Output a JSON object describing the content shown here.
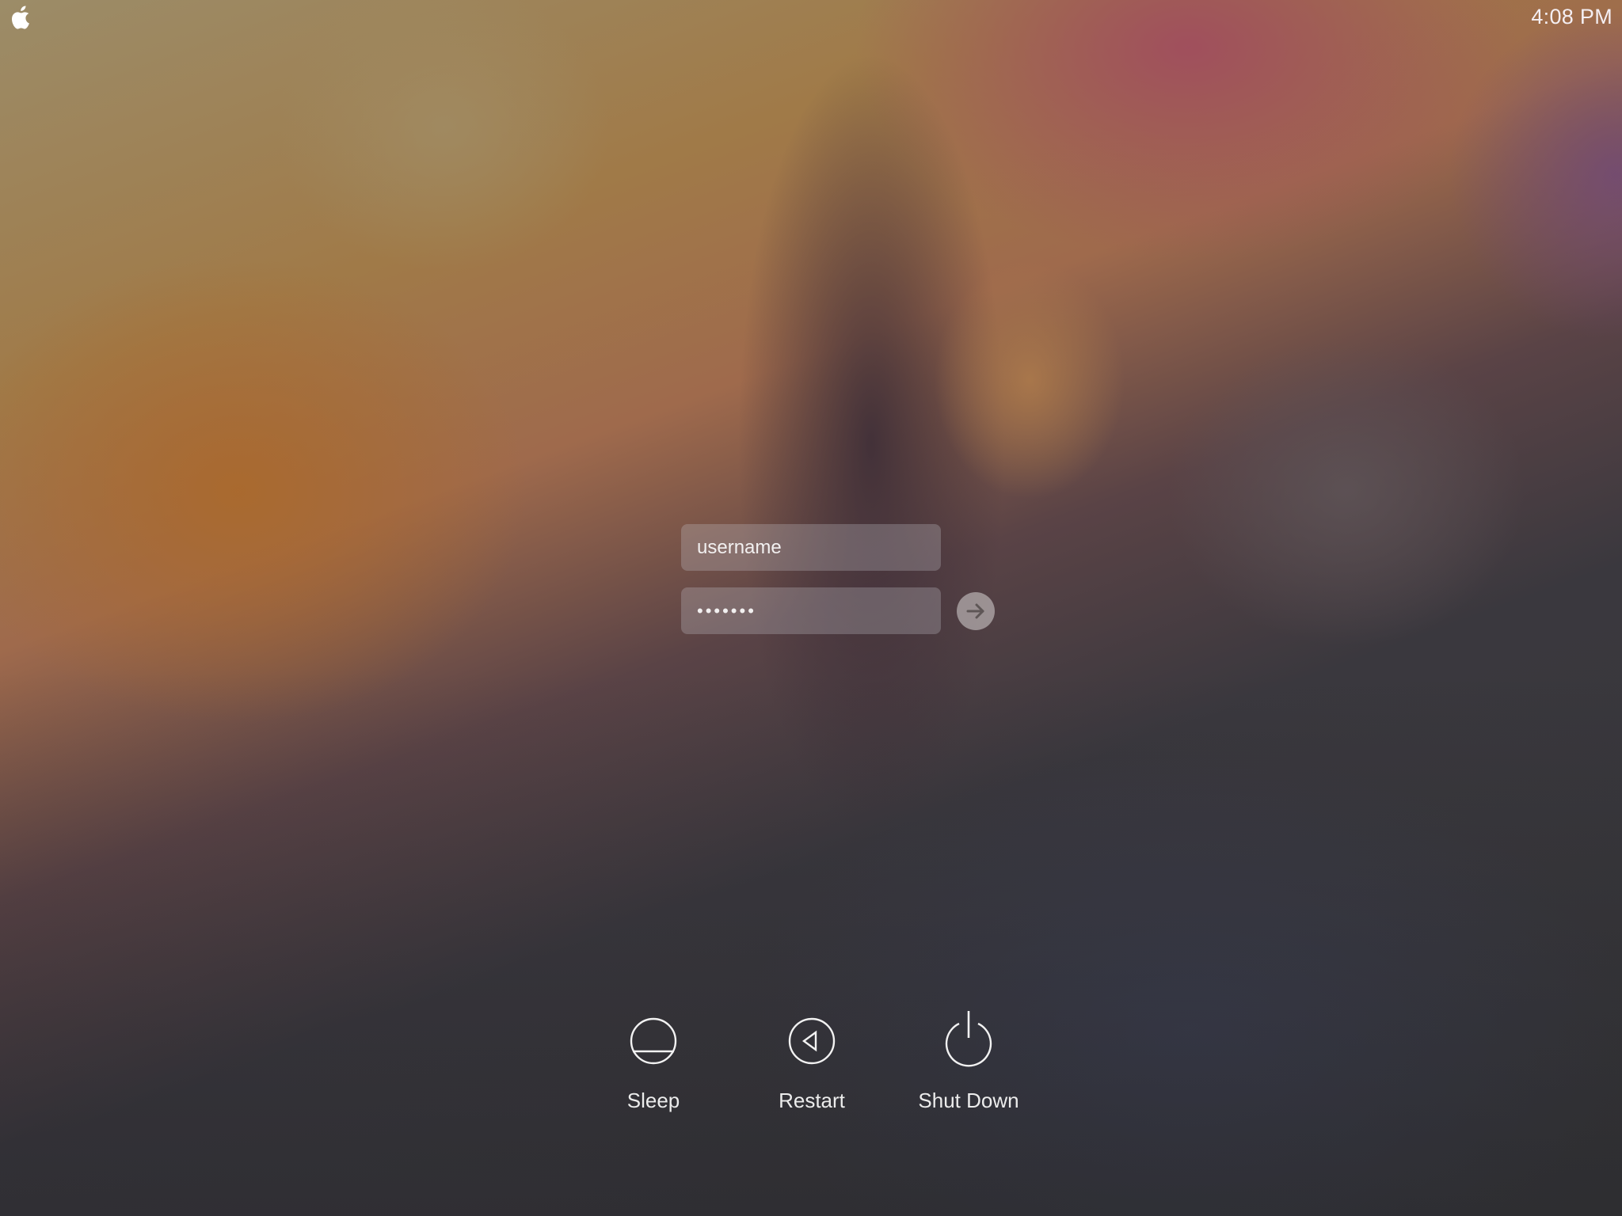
{
  "menubar": {
    "apple_menu_icon": "apple-logo-icon",
    "clock": "4:08 PM"
  },
  "login": {
    "username": {
      "value": "username",
      "placeholder": ""
    },
    "password": {
      "masked_value": "•••••••",
      "length": 7
    },
    "submit_icon": "arrow-right-icon"
  },
  "power_options": [
    {
      "label": "Sleep",
      "icon": "sleep-icon"
    },
    {
      "label": "Restart",
      "icon": "restart-icon"
    },
    {
      "label": "Shut Down",
      "icon": "power-icon"
    }
  ],
  "colors": {
    "text": "#ffffff",
    "field_bg": "rgba(200,200,210,0.28)",
    "submit_bg": "#b3acac",
    "submit_arrow": "#5e5656"
  }
}
